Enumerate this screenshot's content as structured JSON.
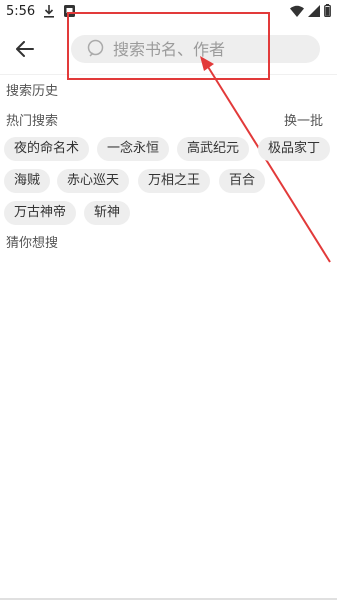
{
  "status_bar": {
    "time": "5:56",
    "icons": [
      "download-icon",
      "notification-icon",
      "wifi-icon",
      "signal-icon",
      "battery-icon"
    ]
  },
  "header": {
    "back_icon": "back-arrow-icon",
    "search": {
      "placeholder": "搜索书名、作者",
      "value": ""
    }
  },
  "history": {
    "title": "搜索历史"
  },
  "hot": {
    "title": "热门搜索",
    "refresh_label": "换一批",
    "tags": [
      "夜的命名术",
      "一念永恒",
      "高武纪元",
      "极品家丁",
      "海贼",
      "赤心巡天",
      "万相之王",
      "百合",
      "万古神帝",
      "斩神"
    ]
  },
  "guess": {
    "title": "猜你想搜"
  },
  "colors": {
    "annotation": "#e23a3a",
    "tag_bg": "#eeeeee"
  }
}
